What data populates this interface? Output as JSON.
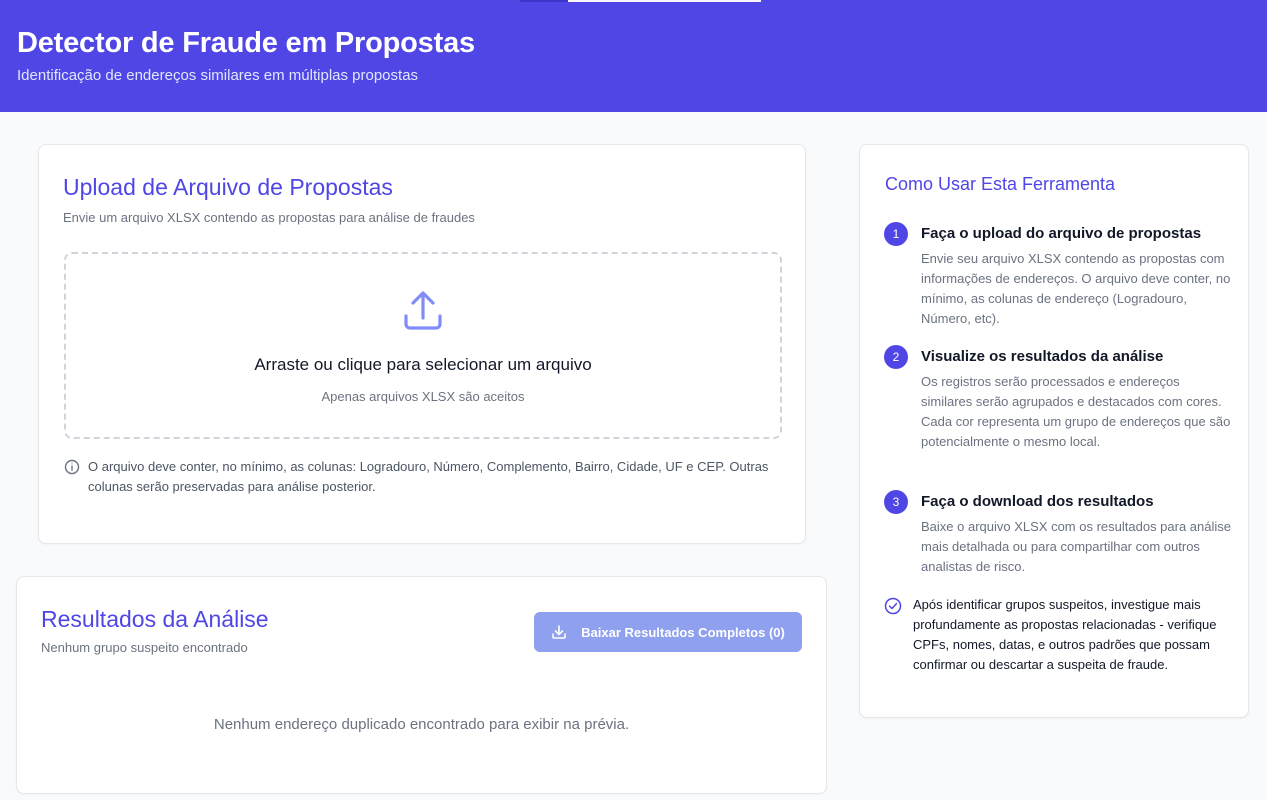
{
  "header": {
    "title": "Detector de Fraude em Propostas",
    "subtitle": "Identificação de endereços similares em múltiplas propostas"
  },
  "upload": {
    "title": "Upload de Arquivo de Propostas",
    "description": "Envie um arquivo XLSX contendo as propostas para análise de fraudes",
    "drop_title": "Arraste ou clique para selecionar um arquivo",
    "drop_hint": "Apenas arquivos XLSX são aceitos",
    "note": "O arquivo deve conter, no mínimo, as colunas: Logradouro, Número, Complemento, Bairro, Cidade, UF e CEP. Outras colunas serão preservadas para análise posterior."
  },
  "results": {
    "title": "Resultados da Análise",
    "description": "Nenhum grupo suspeito encontrado",
    "download_label": "Baixar Resultados Completos (0)",
    "empty_message": "Nenhum endereço duplicado encontrado para exibir na prévia."
  },
  "help": {
    "title": "Como Usar Esta Ferramenta",
    "steps": [
      {
        "number": "1",
        "title": "Faça o upload do arquivo de propostas",
        "description": "Envie seu arquivo XLSX contendo as propostas com informações de endereços. O arquivo deve conter, no mínimo, as colunas de endereço (Logradouro, Número, etc)."
      },
      {
        "number": "2",
        "title": "Visualize os resultados da análise",
        "description": "Os registros serão processados e endereços similares serão agrupados e destacados com cores. Cada cor representa um grupo de endereços que são potencialmente o mesmo local."
      },
      {
        "number": "3",
        "title": "Faça o download dos resultados",
        "description": "Baixe o arquivo XLSX com os resultados para análise mais detalhada ou para compartilhar com outros analistas de risco."
      }
    ],
    "tip": "Após identificar grupos suspeitos, investigue mais profundamente as propostas relacionadas - verifique CPFs, nomes, datas, e outros padrões que possam confirmar ou descartar a suspeita de fraude."
  },
  "icons": {
    "upload": "upload-icon",
    "info": "info-icon",
    "download": "download-icon",
    "check": "check-circle-icon"
  },
  "colors": {
    "primary": "#4f46e5",
    "button_disabled": "#8fa0ef",
    "upload_icon": "#818cf8"
  }
}
